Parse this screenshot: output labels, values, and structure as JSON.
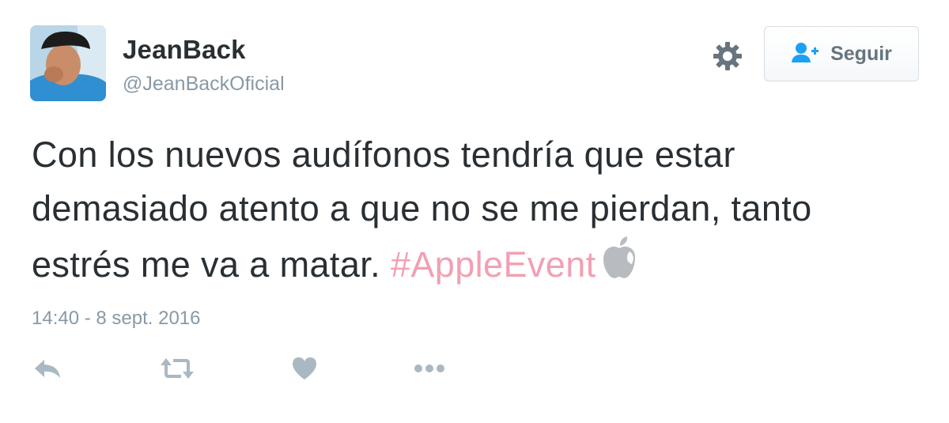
{
  "user": {
    "display_name": "JeanBack",
    "handle": "@JeanBackOficial"
  },
  "follow_button": {
    "label": "Seguir",
    "icon": "follow-user-icon"
  },
  "settings": {
    "icon": "gear-icon"
  },
  "tweet": {
    "text": "Con los nuevos audífonos tendría que estar demasiado atento a que no se me pierdan, tanto estrés me va a matar. ",
    "hashtag": "#AppleEvent",
    "hashflag_icon": "apple-logo-icon",
    "timestamp": "14:40 - 8 sept. 2016"
  },
  "actions": [
    {
      "name": "reply",
      "icon": "reply-icon"
    },
    {
      "name": "retweet",
      "icon": "retweet-icon"
    },
    {
      "name": "like",
      "icon": "heart-icon"
    },
    {
      "name": "more",
      "icon": "more-icon"
    }
  ],
  "colors": {
    "text": "#292f33",
    "muted": "#8899a6",
    "hashtag": "#f1a0b3",
    "follow_icon": "#1da1f2",
    "action_icon": "#aab8c2"
  }
}
